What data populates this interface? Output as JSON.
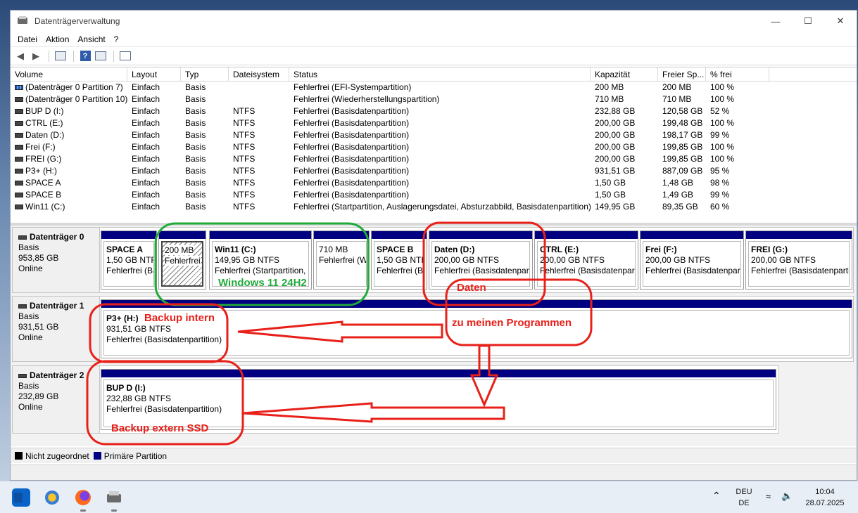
{
  "window": {
    "title": "Datenträgerverwaltung",
    "controls": [
      "—",
      "☐",
      "✕"
    ]
  },
  "menu": [
    "Datei",
    "Aktion",
    "Ansicht",
    "?"
  ],
  "columns": [
    "Volume",
    "Layout",
    "Typ",
    "Dateisystem",
    "Status",
    "Kapazität",
    "Freier Sp...",
    "% frei"
  ],
  "volumes": [
    [
      "(Datenträger 0 Partition 7)",
      "Einfach",
      "Basis",
      "",
      "Fehlerfrei (EFI-Systempartition)",
      "200 MB",
      "200 MB",
      "100 %"
    ],
    [
      "(Datenträger 0 Partition 10)",
      "Einfach",
      "Basis",
      "",
      "Fehlerfrei (Wiederherstellungspartition)",
      "710 MB",
      "710 MB",
      "100 %"
    ],
    [
      "BUP D (I:)",
      "Einfach",
      "Basis",
      "NTFS",
      "Fehlerfrei (Basisdatenpartition)",
      "232,88 GB",
      "120,58 GB",
      "52 %"
    ],
    [
      "CTRL (E:)",
      "Einfach",
      "Basis",
      "NTFS",
      "Fehlerfrei (Basisdatenpartition)",
      "200,00 GB",
      "199,48 GB",
      "100 %"
    ],
    [
      "Daten (D:)",
      "Einfach",
      "Basis",
      "NTFS",
      "Fehlerfrei (Basisdatenpartition)",
      "200,00 GB",
      "198,17 GB",
      "99 %"
    ],
    [
      "Frei (F:)",
      "Einfach",
      "Basis",
      "NTFS",
      "Fehlerfrei (Basisdatenpartition)",
      "200,00 GB",
      "199,85 GB",
      "100 %"
    ],
    [
      "FREI (G:)",
      "Einfach",
      "Basis",
      "NTFS",
      "Fehlerfrei (Basisdatenpartition)",
      "200,00 GB",
      "199,85 GB",
      "100 %"
    ],
    [
      "P3+ (H:)",
      "Einfach",
      "Basis",
      "NTFS",
      "Fehlerfrei (Basisdatenpartition)",
      "931,51 GB",
      "887,09 GB",
      "95 %"
    ],
    [
      "SPACE A",
      "Einfach",
      "Basis",
      "NTFS",
      "Fehlerfrei (Basisdatenpartition)",
      "1,50 GB",
      "1,48 GB",
      "98 %"
    ],
    [
      "SPACE B",
      "Einfach",
      "Basis",
      "NTFS",
      "Fehlerfrei (Basisdatenpartition)",
      "1,50 GB",
      "1,49 GB",
      "99 %"
    ],
    [
      "Win11 (C:)",
      "Einfach",
      "Basis",
      "NTFS",
      "Fehlerfrei (Startpartition, Auslagerungsdatei, Absturzabbild, Basisdatenpartition)",
      "149,95 GB",
      "89,35 GB",
      "60 %"
    ]
  ],
  "disks": [
    {
      "name": "Datenträger 0",
      "type": "Basis",
      "size": "953,85 GB",
      "state": "Online",
      "partitions": [
        {
          "name": "SPACE A",
          "size": "1,50 GB NTFS",
          "status": "Fehlerfrei (Bas"
        },
        {
          "name": "",
          "size": "200 MB",
          "status": "Fehlerfrei"
        },
        {
          "name": "Win11  (C:)",
          "size": "149,95 GB NTFS",
          "status": "Fehlerfrei (Startpartition,"
        },
        {
          "name": "",
          "size": "710 MB",
          "status": "Fehlerfrei (W"
        },
        {
          "name": "SPACE B",
          "size": "1,50 GB NTFS",
          "status": "Fehlerfrei (Bas"
        },
        {
          "name": "Daten  (D:)",
          "size": "200,00 GB NTFS",
          "status": "Fehlerfrei (Basisdatenpart"
        },
        {
          "name": "CTRL  (E:)",
          "size": "200,00 GB NTFS",
          "status": "Fehlerfrei (Basisdatenpart"
        },
        {
          "name": "Frei  (F:)",
          "size": "200,00 GB NTFS",
          "status": "Fehlerfrei (Basisdatenpart"
        },
        {
          "name": "FREI  (G:)",
          "size": "200,00 GB NTFS",
          "status": "Fehlerfrei (Basisdatenpartition)"
        }
      ]
    },
    {
      "name": "Datenträger 1",
      "type": "Basis",
      "size": "931,51 GB",
      "state": "Online",
      "partitions": [
        {
          "name": "P3+  (H:)",
          "size": "931,51 GB NTFS",
          "status": "Fehlerfrei (Basisdatenpartition)"
        }
      ]
    },
    {
      "name": "Datenträger 2",
      "type": "Basis",
      "size": "232,89 GB",
      "state": "Online",
      "partitions": [
        {
          "name": "BUP D  (I:)",
          "size": "232,88 GB NTFS",
          "status": "Fehlerfrei (Basisdatenpartition)"
        }
      ]
    }
  ],
  "legend": [
    {
      "label": "Nicht zugeordnet",
      "color": "#000000"
    },
    {
      "label": "Primäre Partition",
      "color": "#000080"
    }
  ],
  "annotations": {
    "windows": "Windows 11 24H2",
    "daten": "Daten",
    "programme": "zu meinen Programmen",
    "backup_intern": "Backup intern",
    "backup_extern": "Backup extern SSD",
    "green": "#22aa3a",
    "red": "#e8201a"
  },
  "taskbar": {
    "apps": [
      "outlook-icon",
      "settings-sun-icon",
      "firefox-icon",
      "disk-mgmt-icon"
    ],
    "lang_top": "DEU",
    "lang_bottom": "DE",
    "time": "10:04",
    "date": "28.07.2025"
  }
}
